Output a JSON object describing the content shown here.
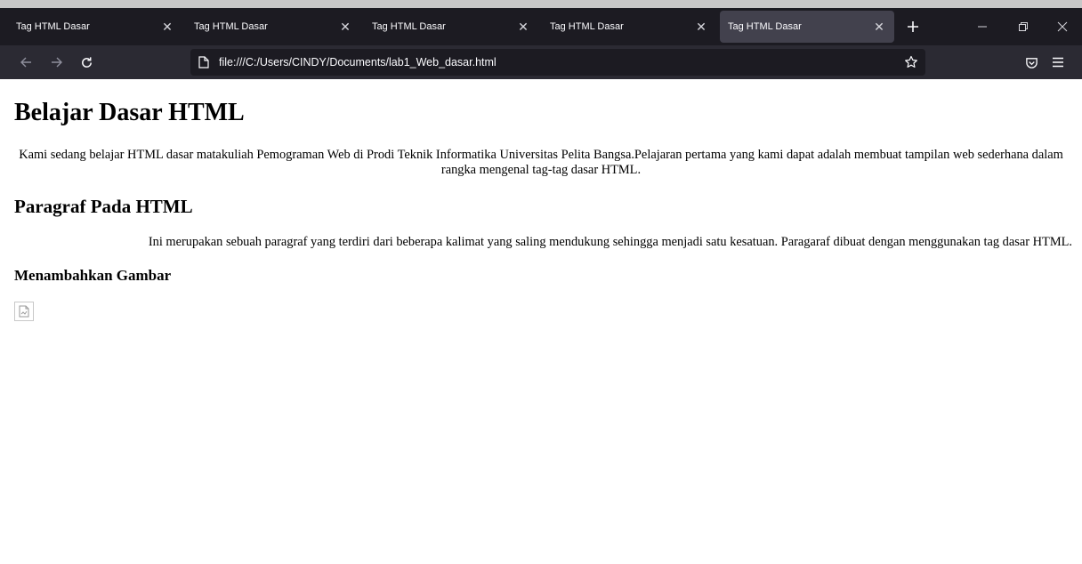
{
  "tabs": [
    {
      "title": "Tag HTML Dasar",
      "active": false
    },
    {
      "title": "Tag HTML Dasar",
      "active": false
    },
    {
      "title": "Tag HTML Dasar",
      "active": false
    },
    {
      "title": "Tag HTML Dasar",
      "active": false
    },
    {
      "title": "Tag HTML Dasar",
      "active": true
    }
  ],
  "toolbar": {
    "url": "file:///C:/Users/CINDY/Documents/lab1_Web_dasar.html"
  },
  "icons": {
    "back": "back-arrow-icon",
    "forward": "forward-arrow-icon",
    "reload": "reload-icon",
    "page": "page-icon",
    "bookmark": "star-icon",
    "pocket": "pocket-icon",
    "menu": "hamburger-menu-icon",
    "new_tab": "plus-icon",
    "tab_close": "close-icon",
    "broken_image": "broken-image-icon"
  },
  "page": {
    "heading1": "Belajar Dasar HTML",
    "paragraph1": "Kami sedang belajar HTML dasar matakuliah Pemograman Web di Prodi Teknik Informatika Universitas Pelita Bangsa.Pelajaran pertama yang kami dapat adalah membuat tampilan web sederhana dalam rangka mengenal tag-tag dasar HTML.",
    "heading2": "Paragraf Pada HTML",
    "paragraph2": "Ini merupakan sebuah paragraf yang terdiri dari beberapa kalimat yang saling mendukung sehingga menjadi satu kesatuan. Paragaraf dibuat dengan menggunakan tag dasar HTML.",
    "heading3": "Menambahkan Gambar"
  },
  "colors": {
    "tabbar_bg": "#1c1b22",
    "active_tab_bg": "#42414d",
    "navbar_bg": "#2b2a33",
    "urlbar_bg": "#1c1b22",
    "chrome_text": "#fbfbfe"
  }
}
